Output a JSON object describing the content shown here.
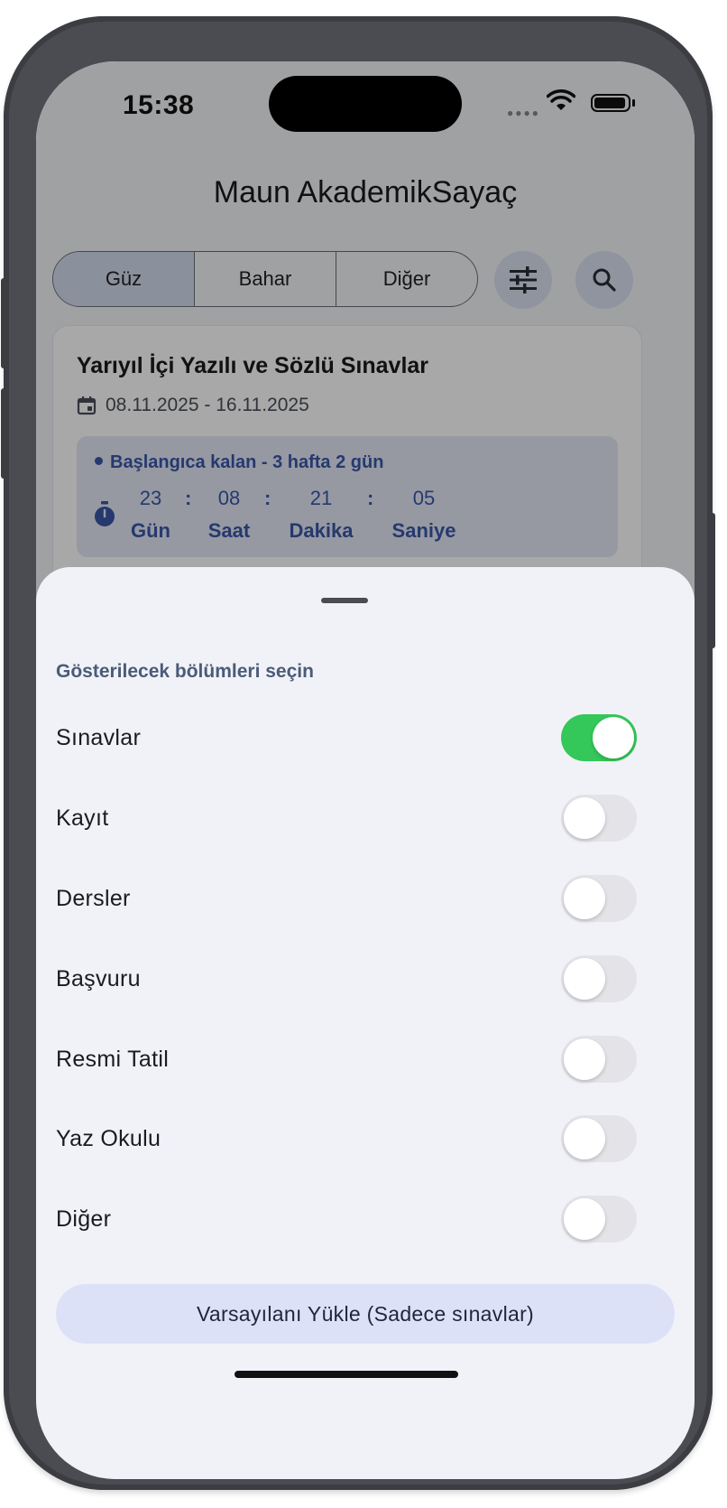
{
  "status_bar": {
    "time": "15:38"
  },
  "app": {
    "title": "Maun AkademikSayaç",
    "tabs": [
      {
        "label": "Güz",
        "active": true
      },
      {
        "label": "Bahar",
        "active": false
      },
      {
        "label": "Diğer",
        "active": false
      }
    ],
    "icons": {
      "filter": "tune-icon",
      "search": "search-icon"
    },
    "event_card": {
      "title": "Yarıyıl İçi Yazılı ve Sözlü Sınavlar",
      "date_range": "08.11.2025 - 16.11.2025",
      "remaining_label": "Başlangıca kalan - 3 hafta 2 gün",
      "countdown": {
        "days": "23",
        "hours": "08",
        "minutes": "21",
        "seconds": "05",
        "days_label": "Gün",
        "hours_label": "Saat",
        "minutes_label": "Dakika",
        "seconds_label": "Saniye",
        "separator": ":"
      }
    }
  },
  "sheet": {
    "title": "Gösterilecek bölümleri seçin",
    "toggles": [
      {
        "label": "Sınavlar",
        "on": true
      },
      {
        "label": "Kayıt",
        "on": false
      },
      {
        "label": "Dersler",
        "on": false
      },
      {
        "label": "Başvuru",
        "on": false
      },
      {
        "label": "Resmi Tatil",
        "on": false
      },
      {
        "label": "Yaz Okulu",
        "on": false
      },
      {
        "label": "Diğer",
        "on": false
      }
    ],
    "reset_button": "Varsayılanı Yükle (Sadece sınavlar)"
  },
  "colors": {
    "toggle_on": "#34c759",
    "accent": "#3b57a8",
    "selected_tab": "#d4dbef",
    "reset_button_bg": "#dde1f7"
  }
}
